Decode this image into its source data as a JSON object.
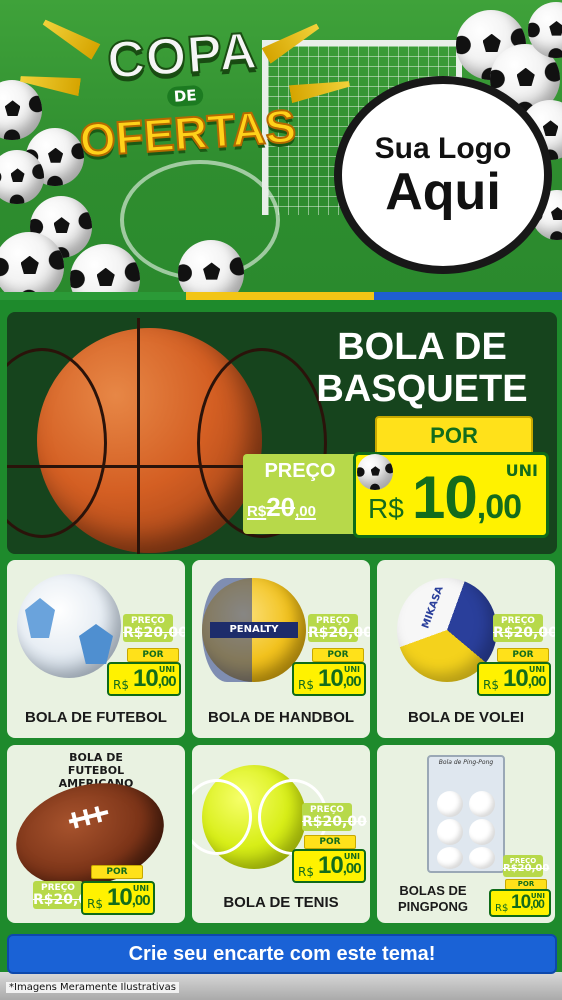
{
  "header": {
    "title_line1": "COPA",
    "title_de": "DE",
    "title_line2": "OFERTAS",
    "logo_line1": "Sua Logo",
    "logo_line2": "Aqui"
  },
  "featured": {
    "name": "BOLA DE BASQUETE",
    "por_label": "POR",
    "preco_label": "PREÇO",
    "old_price_prefix": "R$",
    "old_price_int": "20",
    "old_price_cents": ",00",
    "unit_label": "UNI",
    "currency": "R$",
    "price_int": "10",
    "price_cents": ",00"
  },
  "products": [
    {
      "name": "BOLA DE FUTEBOL",
      "preco_label": "PREÇO",
      "old_price": "R$20,00",
      "por_label": "POR",
      "unit_label": "UNI",
      "currency": "R$",
      "price_int": "10",
      "price_cents": ",00"
    },
    {
      "name": "BOLA DE HANDBOL",
      "preco_label": "PREÇO",
      "old_price": "R$20,00",
      "por_label": "POR",
      "unit_label": "UNI",
      "currency": "R$",
      "price_int": "10",
      "price_cents": ",00"
    },
    {
      "name": "BOLA DE VOLEI",
      "preco_label": "PREÇO",
      "old_price": "R$20,00",
      "por_label": "POR",
      "unit_label": "UNI",
      "currency": "R$",
      "price_int": "10",
      "price_cents": ",00"
    },
    {
      "name": "BOLA DE FUTEBOL AMERICANO",
      "preco_label": "PREÇO",
      "old_price": "R$20,00",
      "por_label": "POR",
      "unit_label": "UNI",
      "currency": "R$",
      "price_int": "10",
      "price_cents": ",00"
    },
    {
      "name": "BOLA DE TENIS",
      "preco_label": "PREÇO",
      "old_price": "R$20,00",
      "por_label": "POR",
      "unit_label": "UNI",
      "currency": "R$",
      "price_int": "10",
      "price_cents": ",00"
    },
    {
      "name": "BOLAS DE PINGPONG",
      "preco_label": "PREÇO",
      "old_price": "R$20,00",
      "por_label": "POR",
      "unit_label": "UNI",
      "currency": "R$",
      "price_int": "10",
      "price_cents": ",00"
    }
  ],
  "product_brands": {
    "handbol": "PENALTY",
    "volei": "MIKASA",
    "pingpong_box": "Bola de Ping-Pong"
  },
  "cta": {
    "label": "Crie seu encarte com este tema!"
  },
  "footer": {
    "note": "*Imagens Meramente Ilustrativas"
  },
  "colors": {
    "background_green": "#1e8a2c",
    "feature_dark_green": "#16441d",
    "price_yellow": "#fff200",
    "preco_lime": "#b7d94a",
    "price_text_green": "#136c1c",
    "cta_blue": "#1a62d6",
    "card_bg": "#e9f2e1"
  },
  "icons": [
    "soccer-ball-icon",
    "trumpet-icon"
  ]
}
